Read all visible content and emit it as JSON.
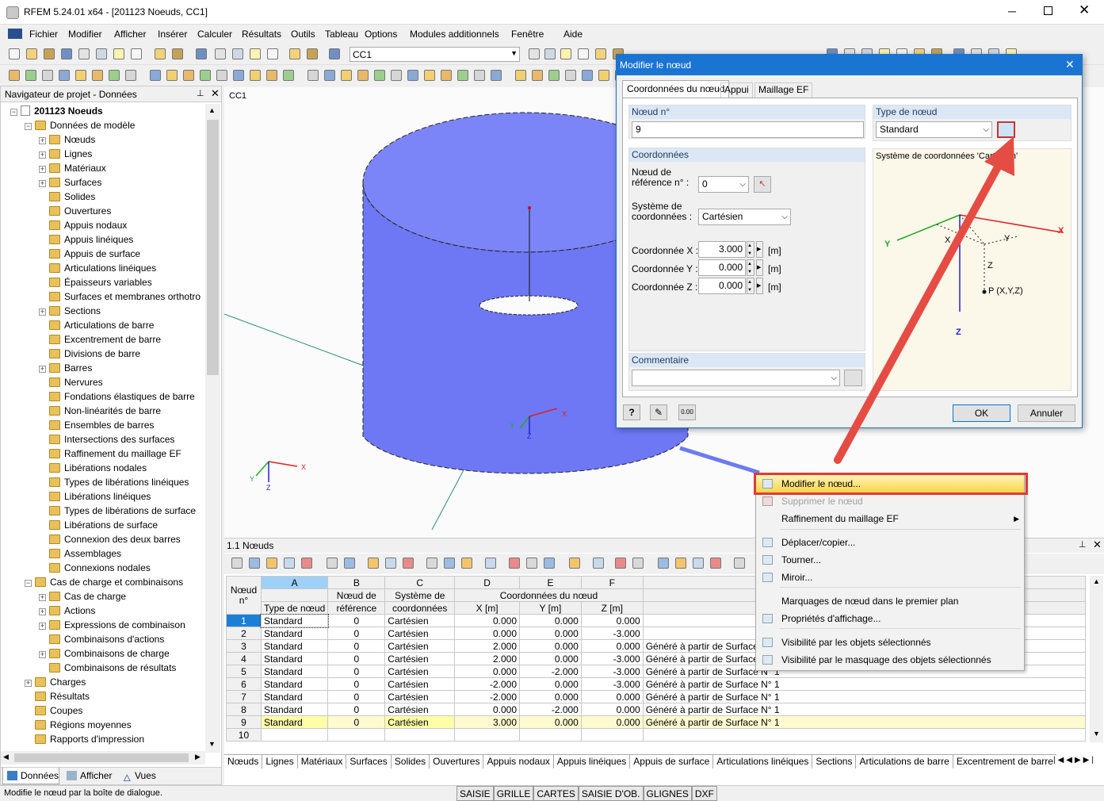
{
  "window": {
    "title": "RFEM 5.24.01 x64 - [201123 Noeuds, CC1]"
  },
  "menu": [
    "Fichier",
    "Modifier",
    "Afficher",
    "Insérer",
    "Calculer",
    "Résultats",
    "Outils",
    "Tableau",
    "Options",
    "Modules additionnels",
    "Fenêtre",
    "Aide"
  ],
  "toolbar": {
    "loadcase": "CC1"
  },
  "navigator": {
    "title": "Navigateur de projet - Données",
    "root": "201123 Noeuds",
    "model": "Données de modèle",
    "items": [
      "Nœuds",
      "Lignes",
      "Matériaux",
      "Surfaces",
      "Solides",
      "Ouvertures",
      "Appuis nodaux",
      "Appuis linéiques",
      "Appuis de surface",
      "Articulations linéiques",
      "Épaisseurs variables",
      "Surfaces et membranes orthotro",
      "Sections",
      "Articulations de barre",
      "Excentrement de barre",
      "Divisions de barre",
      "Barres",
      "Nervures",
      "Fondations élastiques de barre",
      "Non-linéarités de barre",
      "Ensembles de barres",
      "Intersections des surfaces",
      "Raffinement du maillage EF",
      "Libérations nodales",
      "Types de libérations linéiques",
      "Libérations linéiques",
      "Types de libérations de surface",
      "Libérations de surface",
      "Connexion des deux barres",
      "Assemblages",
      "Connexions nodales"
    ],
    "loads": "Cas de charge et combinaisons",
    "load_items": [
      "Cas de charge",
      "Actions",
      "Expressions de combinaison",
      "Combinaisons d'actions",
      "Combinaisons de charge",
      "Combinaisons de résultats"
    ],
    "others": [
      "Charges",
      "Résultats",
      "Coupes",
      "Régions moyennes",
      "Rapports d'impression"
    ],
    "tabs": [
      "Données",
      "Afficher",
      "Vues"
    ]
  },
  "view": {
    "label": "CC1",
    "axes": {
      "x": "X",
      "y": "Y",
      "z": "Z"
    }
  },
  "dialog": {
    "title": "Modifier le nœud",
    "tabs": [
      "Coordonnées du nœud",
      "Appui",
      "Maillage EF"
    ],
    "node_no_label": "Nœud n°",
    "node_no": "9",
    "node_type_label": "Type de nœud",
    "node_type": "Standard",
    "coords_title": "Coordonnées",
    "ref_label_1": "Nœud de",
    "ref_label_2": "référence n° :",
    "ref_value": "0",
    "sys_label_1": "Système de",
    "sys_label_2": "coordonnées :",
    "sys_value": "Cartésien",
    "x_label": "Coordonnée X :",
    "x_value": "3.000",
    "y_label": "Coordonnée Y :",
    "y_value": "0.000",
    "z_label": "Coordonnée Z :",
    "z_value": "0.000",
    "unit": "[m]",
    "comment_title": "Commentaire",
    "preview_title": "Système de coordonnées 'Cartésien'",
    "preview_p": "P (X,Y,Z)",
    "ok": "OK",
    "cancel": "Annuler",
    "calc_icon": "0.00"
  },
  "context_menu": [
    "Modifier le nœud...",
    "Supprimer le nœud",
    "Raffinement du maillage EF",
    "Déplacer/copier...",
    "Tourner...",
    "Miroir...",
    "Marquages de nœud dans le premier plan",
    "Propriétés d'affichage...",
    "Visibilité par les objets sélectionnés",
    "Visibilité par le masquage des objets sélectionnés"
  ],
  "table": {
    "title": "1.1 Nœuds",
    "col_letters": [
      "A",
      "B",
      "C",
      "D",
      "E",
      "F"
    ],
    "h_no1": "Nœud",
    "h_no2": "n°",
    "h_type": "Type de nœud",
    "h_ref1": "Nœud de",
    "h_ref2": "référence",
    "h_sys1": "Système de",
    "h_sys2": "coordonnées",
    "h_coord": "Coordonnées du nœud",
    "h_x": "X [m]",
    "h_y": "Y [m]",
    "h_z": "Z [m]",
    "rows": [
      {
        "no": "1",
        "type": "Standard",
        "ref": "0",
        "sys": "Cartésien",
        "x": "0.000",
        "y": "0.000",
        "z": "0.000",
        "c": ""
      },
      {
        "no": "2",
        "type": "Standard",
        "ref": "0",
        "sys": "Cartésien",
        "x": "0.000",
        "y": "0.000",
        "z": "-3.000",
        "c": ""
      },
      {
        "no": "3",
        "type": "Standard",
        "ref": "0",
        "sys": "Cartésien",
        "x": "2.000",
        "y": "0.000",
        "z": "0.000",
        "c": "Généré à partir de Surface N° 1"
      },
      {
        "no": "4",
        "type": "Standard",
        "ref": "0",
        "sys": "Cartésien",
        "x": "2.000",
        "y": "0.000",
        "z": "-3.000",
        "c": "Généré à partir de Surface N° 1"
      },
      {
        "no": "5",
        "type": "Standard",
        "ref": "0",
        "sys": "Cartésien",
        "x": "0.000",
        "y": "-2.000",
        "z": "-3.000",
        "c": "Généré à partir de Surface N° 1"
      },
      {
        "no": "6",
        "type": "Standard",
        "ref": "0",
        "sys": "Cartésien",
        "x": "-2.000",
        "y": "0.000",
        "z": "-3.000",
        "c": "Généré à partir de Surface N° 1"
      },
      {
        "no": "7",
        "type": "Standard",
        "ref": "0",
        "sys": "Cartésien",
        "x": "-2.000",
        "y": "0.000",
        "z": "0.000",
        "c": "Généré à partir de Surface N° 1"
      },
      {
        "no": "8",
        "type": "Standard",
        "ref": "0",
        "sys": "Cartésien",
        "x": "0.000",
        "y": "-2.000",
        "z": "0.000",
        "c": "Généré à partir de Surface N° 1"
      },
      {
        "no": "9",
        "type": "Standard",
        "ref": "0",
        "sys": "Cartésien",
        "x": "3.000",
        "y": "0.000",
        "z": "0.000",
        "c": "Généré à partir de Surface N° 1"
      },
      {
        "no": "10",
        "type": "",
        "ref": "",
        "sys": "",
        "x": "",
        "y": "",
        "z": "",
        "c": ""
      }
    ],
    "tabs": [
      "Nœuds",
      "Lignes",
      "Matériaux",
      "Surfaces",
      "Solides",
      "Ouvertures",
      "Appuis nodaux",
      "Appuis linéiques",
      "Appuis de surface",
      "Articulations linéiques",
      "Sections",
      "Articulations de barre",
      "Excentrement de barre"
    ]
  },
  "status": {
    "text": "Modifie le nœud par la boîte de dialogue.",
    "buttons": [
      "SAISIE",
      "GRILLE",
      "CARTES",
      "SAISIE D'OB.",
      "GLIGNES",
      "DXF"
    ]
  },
  "colors": {
    "accent": "#0078d7",
    "highlight_red": "#e03c31",
    "cylinder": "#6e78f5"
  }
}
